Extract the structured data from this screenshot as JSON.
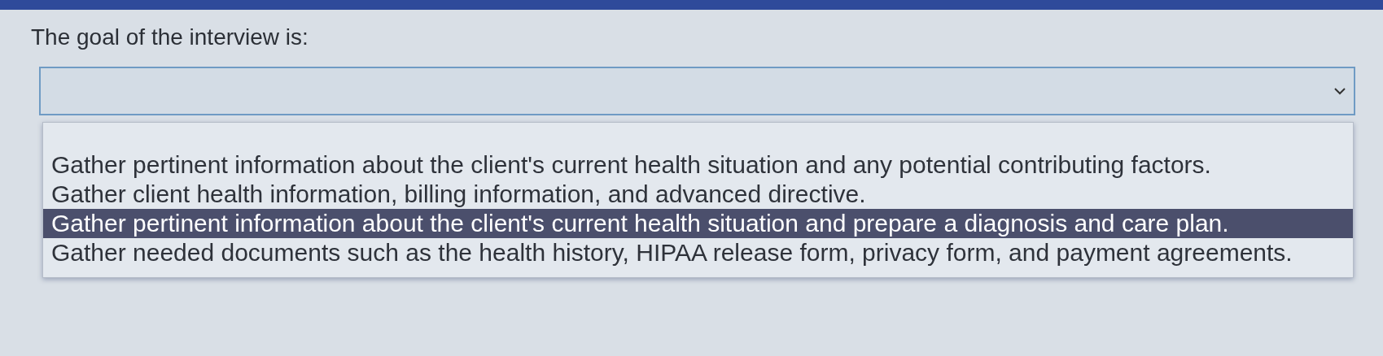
{
  "question": "The goal of the interview is:",
  "dropdown": {
    "expanded": true,
    "options": [
      {
        "label": "Gather pertinent information about the client's current health situation and any potential contributing factors.",
        "selected": false
      },
      {
        "label": "Gather client health information, billing information, and advanced directive.",
        "selected": false
      },
      {
        "label": "Gather pertinent information about the client's current health situation and prepare a diagnosis and care plan.",
        "selected": true
      },
      {
        "label": "Gather needed documents such as the health history, HIPAA release form, privacy form, and payment agreements.",
        "selected": false
      }
    ]
  }
}
